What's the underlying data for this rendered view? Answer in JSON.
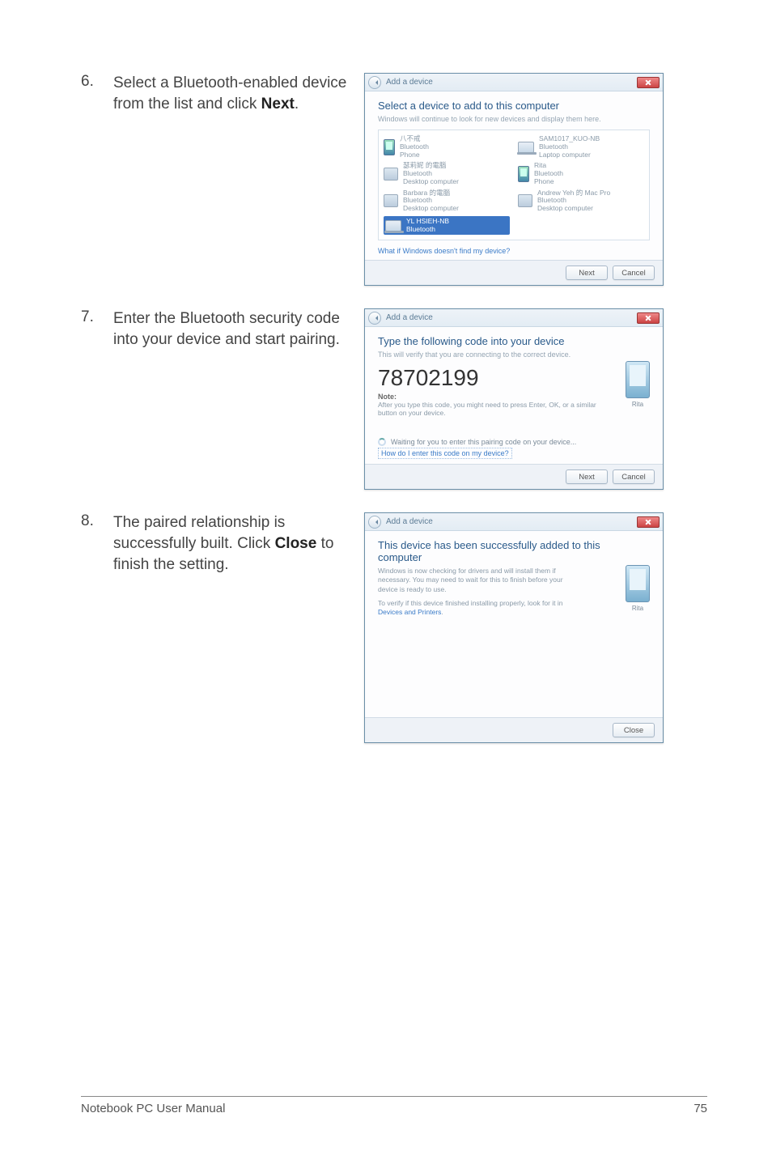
{
  "steps": {
    "six": {
      "num": "6.",
      "text_a": "Select a Bluetooth-enabled device from the list and click ",
      "bold": "Next",
      "text_b": "."
    },
    "seven": {
      "num": "7.",
      "text": "Enter the Bluetooth security code into your device and start pairing."
    },
    "eight": {
      "num": "8.",
      "text_a": "The paired relationship is successfully built. Click ",
      "bold": "Close",
      "text_b": " to finish the setting."
    }
  },
  "dialog_common": {
    "window_title": "Add a device"
  },
  "dialog6": {
    "heading": "Select a device to add to this computer",
    "sub": "Windows will continue to look for new devices and display them here.",
    "devices": [
      {
        "name": "八不戒",
        "sub1": "Bluetooth",
        "sub2": "Phone",
        "icon": "phone"
      },
      {
        "name": "SAM1017_KUO-NB",
        "sub1": "Bluetooth",
        "sub2": "Laptop computer",
        "icon": "laptop"
      },
      {
        "name": "瑟莉妮 的電腦",
        "sub1": "Bluetooth",
        "sub2": "Desktop computer",
        "icon": "pc"
      },
      {
        "name": "Rita",
        "sub1": "Bluetooth",
        "sub2": "Phone",
        "icon": "phone"
      },
      {
        "name": "Barbara 的電腦",
        "sub1": "Bluetooth",
        "sub2": "Desktop computer",
        "icon": "pc"
      },
      {
        "name": "Andrew Yeh 的 Mac Pro",
        "sub1": "Bluetooth",
        "sub2": "Desktop computer",
        "icon": "pc"
      },
      {
        "name": "YL HSIEH-NB",
        "sub1": "Bluetooth",
        "sub2": "",
        "icon": "laptop",
        "selected": true
      }
    ],
    "link": "What if Windows doesn't find my device?",
    "buttons": {
      "next": "Next",
      "cancel": "Cancel"
    }
  },
  "dialog7": {
    "heading": "Type the following code into your device",
    "sub": "This will verify that you are connecting to the correct device.",
    "code": "78702199",
    "note_head": "Note:",
    "note_body": "After you type this code, you might need to press Enter, OK, or a similar button on your device.",
    "waiting": "Waiting for you to enter this pairing code on your device...",
    "link": "How do I enter this code on my device?",
    "phone_label": "Rita",
    "buttons": {
      "next": "Next",
      "cancel": "Cancel"
    }
  },
  "dialog8": {
    "heading": "This device has been successfully added to this computer",
    "body1": "Windows is now checking for drivers and will install them if necessary. You may need to wait for this to finish before your device is ready to use.",
    "body2": "To verify if this device finished installing properly, look for it in ",
    "link": "Devices and Printers",
    "phone_label": "Rita",
    "buttons": {
      "close": "Close"
    }
  },
  "footer": {
    "left": "Notebook PC User Manual",
    "right": "75"
  }
}
